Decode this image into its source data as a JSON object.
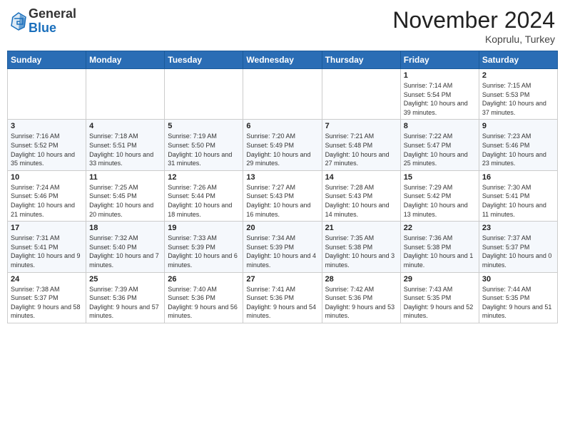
{
  "header": {
    "logo": {
      "line1": "General",
      "line2": "Blue"
    },
    "title": "November 2024",
    "location": "Koprulu, Turkey"
  },
  "weekdays": [
    "Sunday",
    "Monday",
    "Tuesday",
    "Wednesday",
    "Thursday",
    "Friday",
    "Saturday"
  ],
  "weeks": [
    [
      null,
      null,
      null,
      null,
      null,
      {
        "day": 1,
        "sunrise": "7:14 AM",
        "sunset": "5:54 PM",
        "daylight": "10 hours and 39 minutes."
      },
      {
        "day": 2,
        "sunrise": "7:15 AM",
        "sunset": "5:53 PM",
        "daylight": "10 hours and 37 minutes."
      }
    ],
    [
      {
        "day": 3,
        "sunrise": "7:16 AM",
        "sunset": "5:52 PM",
        "daylight": "10 hours and 35 minutes."
      },
      {
        "day": 4,
        "sunrise": "7:18 AM",
        "sunset": "5:51 PM",
        "daylight": "10 hours and 33 minutes."
      },
      {
        "day": 5,
        "sunrise": "7:19 AM",
        "sunset": "5:50 PM",
        "daylight": "10 hours and 31 minutes."
      },
      {
        "day": 6,
        "sunrise": "7:20 AM",
        "sunset": "5:49 PM",
        "daylight": "10 hours and 29 minutes."
      },
      {
        "day": 7,
        "sunrise": "7:21 AM",
        "sunset": "5:48 PM",
        "daylight": "10 hours and 27 minutes."
      },
      {
        "day": 8,
        "sunrise": "7:22 AM",
        "sunset": "5:47 PM",
        "daylight": "10 hours and 25 minutes."
      },
      {
        "day": 9,
        "sunrise": "7:23 AM",
        "sunset": "5:46 PM",
        "daylight": "10 hours and 23 minutes."
      }
    ],
    [
      {
        "day": 10,
        "sunrise": "7:24 AM",
        "sunset": "5:46 PM",
        "daylight": "10 hours and 21 minutes."
      },
      {
        "day": 11,
        "sunrise": "7:25 AM",
        "sunset": "5:45 PM",
        "daylight": "10 hours and 20 minutes."
      },
      {
        "day": 12,
        "sunrise": "7:26 AM",
        "sunset": "5:44 PM",
        "daylight": "10 hours and 18 minutes."
      },
      {
        "day": 13,
        "sunrise": "7:27 AM",
        "sunset": "5:43 PM",
        "daylight": "10 hours and 16 minutes."
      },
      {
        "day": 14,
        "sunrise": "7:28 AM",
        "sunset": "5:43 PM",
        "daylight": "10 hours and 14 minutes."
      },
      {
        "day": 15,
        "sunrise": "7:29 AM",
        "sunset": "5:42 PM",
        "daylight": "10 hours and 13 minutes."
      },
      {
        "day": 16,
        "sunrise": "7:30 AM",
        "sunset": "5:41 PM",
        "daylight": "10 hours and 11 minutes."
      }
    ],
    [
      {
        "day": 17,
        "sunrise": "7:31 AM",
        "sunset": "5:41 PM",
        "daylight": "10 hours and 9 minutes."
      },
      {
        "day": 18,
        "sunrise": "7:32 AM",
        "sunset": "5:40 PM",
        "daylight": "10 hours and 7 minutes."
      },
      {
        "day": 19,
        "sunrise": "7:33 AM",
        "sunset": "5:39 PM",
        "daylight": "10 hours and 6 minutes."
      },
      {
        "day": 20,
        "sunrise": "7:34 AM",
        "sunset": "5:39 PM",
        "daylight": "10 hours and 4 minutes."
      },
      {
        "day": 21,
        "sunrise": "7:35 AM",
        "sunset": "5:38 PM",
        "daylight": "10 hours and 3 minutes."
      },
      {
        "day": 22,
        "sunrise": "7:36 AM",
        "sunset": "5:38 PM",
        "daylight": "10 hours and 1 minute."
      },
      {
        "day": 23,
        "sunrise": "7:37 AM",
        "sunset": "5:37 PM",
        "daylight": "10 hours and 0 minutes."
      }
    ],
    [
      {
        "day": 24,
        "sunrise": "7:38 AM",
        "sunset": "5:37 PM",
        "daylight": "9 hours and 58 minutes."
      },
      {
        "day": 25,
        "sunrise": "7:39 AM",
        "sunset": "5:36 PM",
        "daylight": "9 hours and 57 minutes."
      },
      {
        "day": 26,
        "sunrise": "7:40 AM",
        "sunset": "5:36 PM",
        "daylight": "9 hours and 56 minutes."
      },
      {
        "day": 27,
        "sunrise": "7:41 AM",
        "sunset": "5:36 PM",
        "daylight": "9 hours and 54 minutes."
      },
      {
        "day": 28,
        "sunrise": "7:42 AM",
        "sunset": "5:36 PM",
        "daylight": "9 hours and 53 minutes."
      },
      {
        "day": 29,
        "sunrise": "7:43 AM",
        "sunset": "5:35 PM",
        "daylight": "9 hours and 52 minutes."
      },
      {
        "day": 30,
        "sunrise": "7:44 AM",
        "sunset": "5:35 PM",
        "daylight": "9 hours and 51 minutes."
      }
    ]
  ]
}
